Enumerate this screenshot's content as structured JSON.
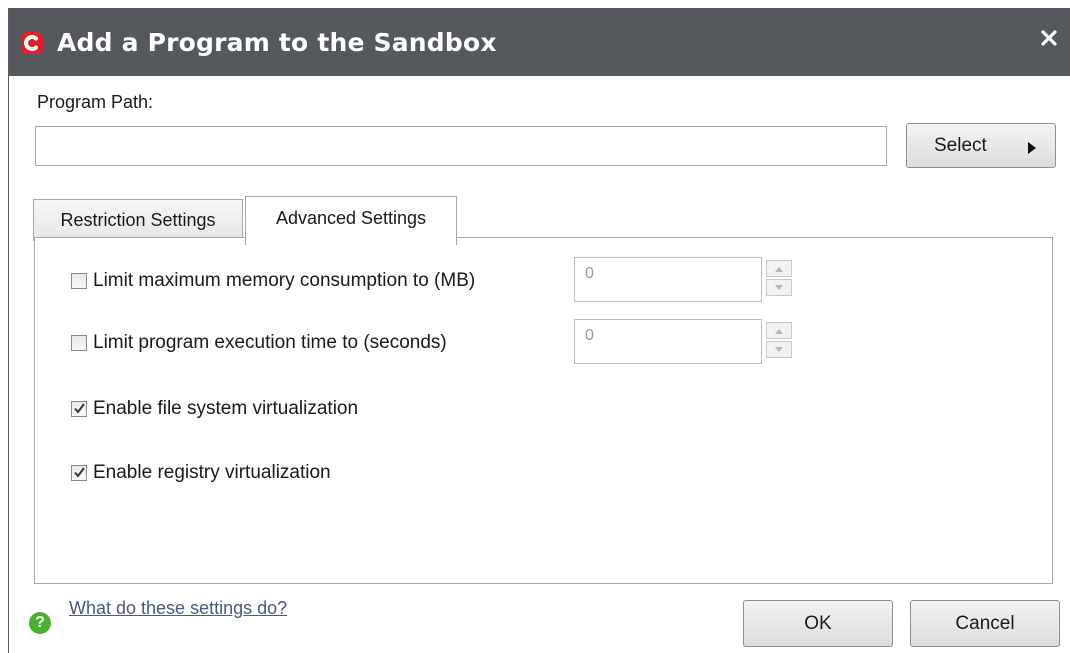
{
  "window": {
    "title": "Add a Program to the Sandbox",
    "logo_letter": "C"
  },
  "program_path": {
    "label": "Program Path:",
    "value": "",
    "placeholder": "",
    "select_label": "Select"
  },
  "tabs": [
    {
      "label": "Restriction Settings",
      "active": false
    },
    {
      "label": "Advanced Settings",
      "active": true
    }
  ],
  "advanced": {
    "options": [
      {
        "label": "Limit maximum memory consumption to (MB)",
        "checked": false,
        "value": "0"
      },
      {
        "label": "Limit program execution time to (seconds)",
        "checked": false,
        "value": "0"
      },
      {
        "label": "Enable file system virtualization",
        "checked": true
      },
      {
        "label": "Enable registry virtualization",
        "checked": true
      }
    ]
  },
  "footer": {
    "help_link": "What do these settings do?",
    "help_icon": "?",
    "ok_label": "OK",
    "cancel_label": "Cancel"
  },
  "colors": {
    "titlebar": "#55595e",
    "logo": "#e01e25",
    "help_icon": "#4caf32"
  }
}
